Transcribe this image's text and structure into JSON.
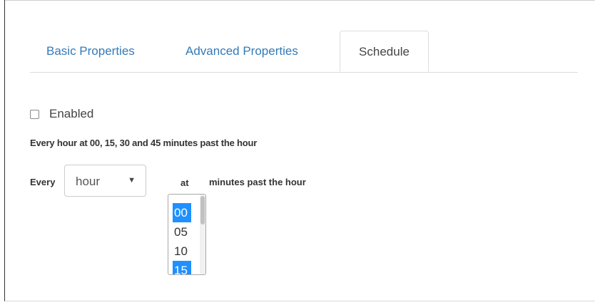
{
  "tabs": [
    {
      "label": "Basic Properties",
      "active": false
    },
    {
      "label": "Advanced Properties",
      "active": false
    },
    {
      "label": "Schedule",
      "active": true
    }
  ],
  "schedule": {
    "enabled_label": "Enabled",
    "enabled_checked": false,
    "summary": "Every hour at 00, 15, 30 and 45 minutes past the hour",
    "every_label": "Every",
    "period_value": "hour",
    "at_label": "at",
    "minutes_past_label": "minutes past the hour",
    "minute_options": [
      {
        "value": "00",
        "selected": true
      },
      {
        "value": "05",
        "selected": false
      },
      {
        "value": "10",
        "selected": false
      },
      {
        "value": "15",
        "selected": true
      }
    ]
  },
  "colors": {
    "link": "#337ab7",
    "selected_option": "#1e90ff"
  },
  "icons": {
    "dropdown": "caret-down-icon"
  }
}
